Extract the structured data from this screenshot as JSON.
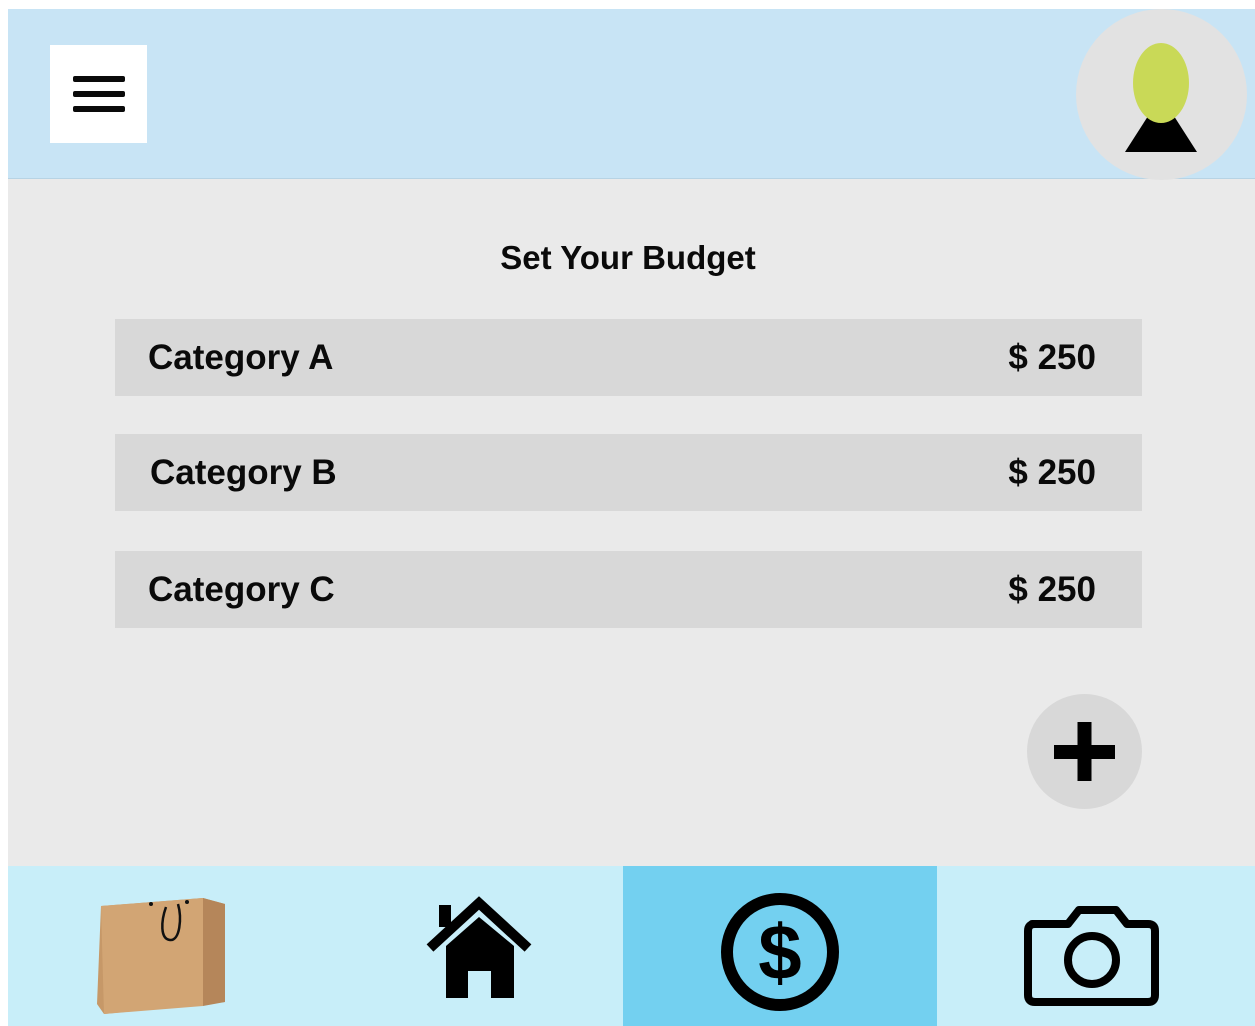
{
  "header": {
    "menu_icon": "hamburger-menu-icon",
    "avatar_icon": "user-avatar-icon"
  },
  "main": {
    "title": "Set Your Budget",
    "categories": [
      {
        "name": "Category A",
        "amount": "$ 250"
      },
      {
        "name": "Category B",
        "amount": "$ 250"
      },
      {
        "name": "Category C",
        "amount": "$ 250"
      }
    ],
    "add_icon": "plus-icon"
  },
  "nav": {
    "items": [
      {
        "icon": "shopping-bag-icon",
        "active": false
      },
      {
        "icon": "home-icon",
        "active": false
      },
      {
        "icon": "dollar-icon",
        "active": true
      },
      {
        "icon": "camera-icon",
        "active": false
      }
    ]
  },
  "colors": {
    "header_bg": "#c8e4f5",
    "content_bg": "#eaeaea",
    "row_bg": "#d8d8d8",
    "nav_bg": "#c8eef9",
    "nav_active_bg": "#73d0f0",
    "avatar_head": "#c9d957"
  }
}
